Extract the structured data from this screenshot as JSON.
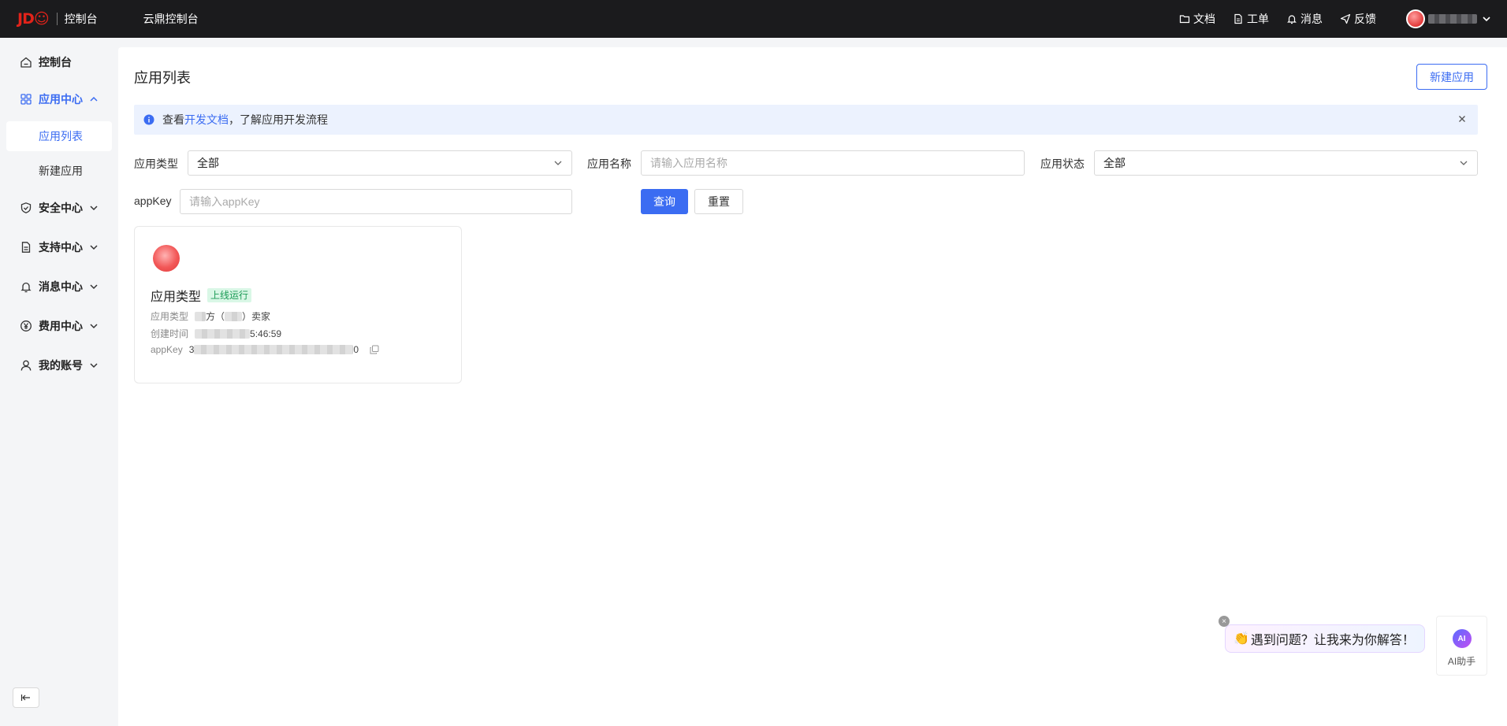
{
  "topbar": {
    "logo_mark": "JD☺",
    "logo_text": "控制台",
    "brand": "云鼎控制台",
    "nav": [
      {
        "label": "文档",
        "icon": "folder-icon"
      },
      {
        "label": "工单",
        "icon": "document-icon"
      },
      {
        "label": "消息",
        "icon": "bell-icon"
      },
      {
        "label": "反馈",
        "icon": "send-icon"
      }
    ]
  },
  "sidebar": {
    "items": [
      {
        "label": "控制台",
        "icon": "home-icon"
      },
      {
        "label": "应用中心",
        "icon": "grid-icon",
        "expanded": true
      },
      {
        "label": "安全中心",
        "icon": "shield-icon"
      },
      {
        "label": "支持中心",
        "icon": "document-icon"
      },
      {
        "label": "消息中心",
        "icon": "bell-icon"
      },
      {
        "label": "费用中心",
        "icon": "yen-icon"
      },
      {
        "label": "我的账号",
        "icon": "user-icon"
      }
    ],
    "sub_items": [
      {
        "label": "应用列表",
        "active": true
      },
      {
        "label": "新建应用",
        "active": false
      }
    ]
  },
  "main": {
    "title": "应用列表",
    "new_app_button": "新建应用",
    "notice": {
      "prefix": "查看",
      "link": "开发文档",
      "suffix": "，了解应用开发流程"
    },
    "filters": {
      "app_type_label": "应用类型",
      "app_type_value": "全部",
      "app_name_label": "应用名称",
      "app_name_placeholder": "请输入应用名称",
      "app_status_label": "应用状态",
      "app_status_value": "全部",
      "appkey_label": "appKey",
      "appkey_placeholder": "请输入appKey",
      "query_button": "查询",
      "reset_button": "重置"
    },
    "card": {
      "title": "应用类型",
      "status": "上线运行",
      "type_label": "应用类型",
      "type_value_mid": "方（",
      "type_value_end": "）卖家",
      "created_label": "创建时间",
      "created_value_end": "5:46:59",
      "appkey_label": "appKey",
      "appkey_start": "3",
      "appkey_end": "0"
    }
  },
  "ai_helper": {
    "bubble_text": "遇到问题？让我来为你解答！",
    "bubble_emoji": "👏",
    "logo_text": "AI",
    "label": "AI助手"
  },
  "colors": {
    "accent": "#3b6cf2",
    "topbar": "#1b1b1d",
    "status_green": "#1a9a55",
    "notice_bg": "#ecf2fe"
  }
}
